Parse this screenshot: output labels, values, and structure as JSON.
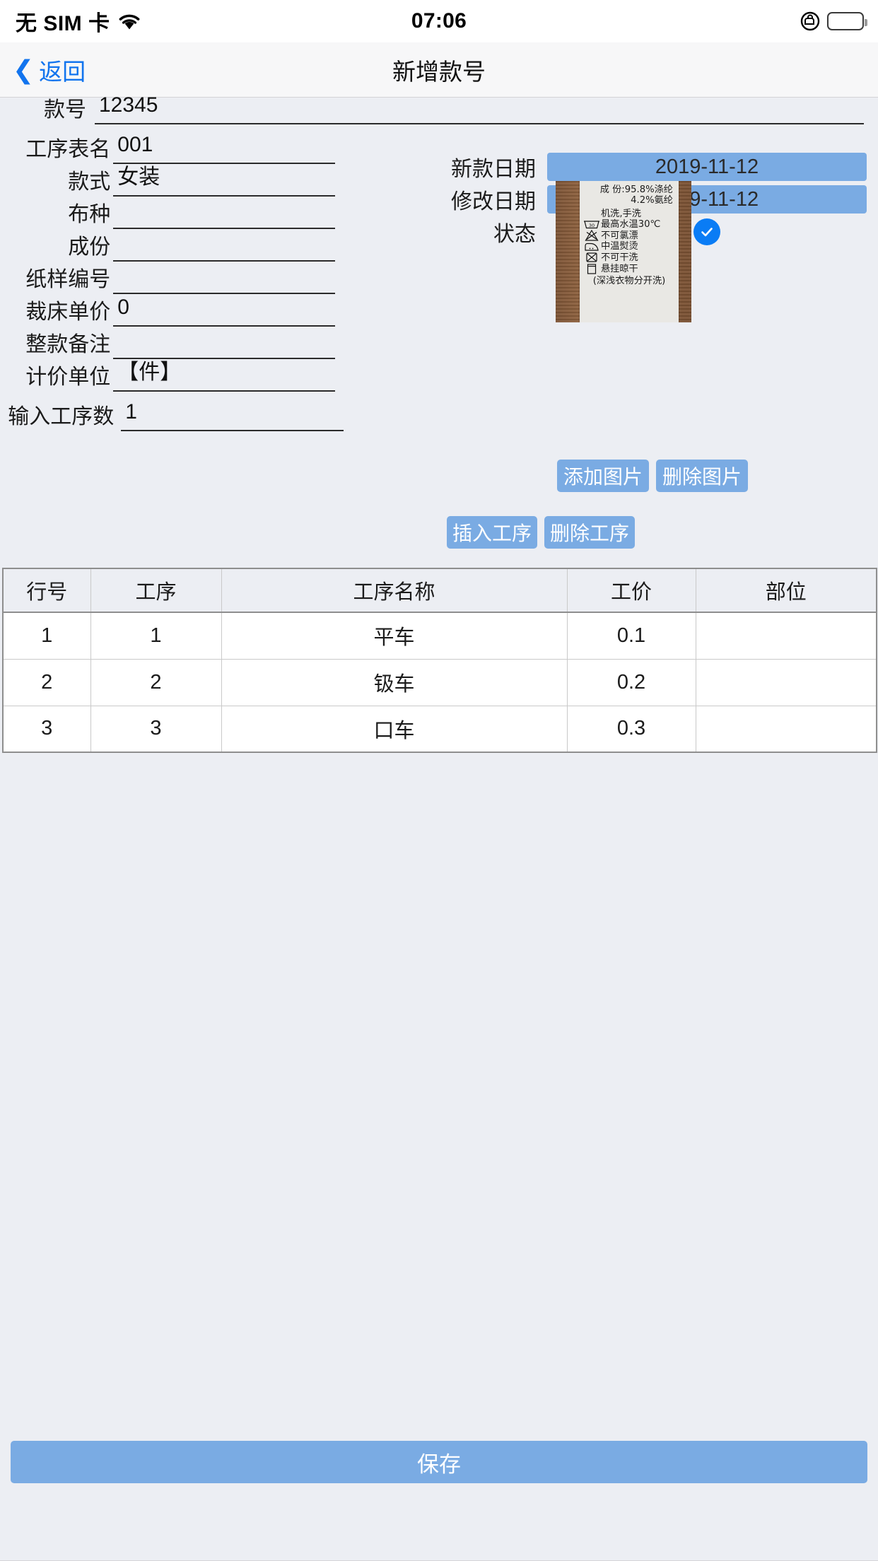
{
  "status_bar": {
    "carrier": "无 SIM 卡",
    "wifi_icon": "wifi-icon",
    "time": "07:06",
    "orientation_lock_icon": "rotation-lock-icon",
    "battery_icon": "battery-full-icon"
  },
  "nav_bar": {
    "back_icon": "chevron-left-icon",
    "back_label": "返回",
    "title": "新增款号"
  },
  "form_left": [
    {
      "label": "款号",
      "value": "12345"
    },
    {
      "label": "工序表名",
      "value": "001"
    },
    {
      "label": "款式",
      "value": "女装"
    },
    {
      "label": "布种",
      "value": ""
    },
    {
      "label": "成份",
      "value": ""
    },
    {
      "label": "纸样编号",
      "value": ""
    },
    {
      "label": "裁床单价",
      "value": "0"
    },
    {
      "label": "整款备注",
      "value": ""
    },
    {
      "label": "计价单位",
      "value": "【件】"
    },
    {
      "label": "输入工序数",
      "value": "1"
    }
  ],
  "form_right": {
    "new_date_label": "新款日期",
    "new_date_value": "2019-11-12",
    "modify_date_label": "修改日期",
    "modify_date_value": "2019-11-12",
    "status_label": "状态",
    "status_checked_icon": "check-circle-icon"
  },
  "photo": {
    "alt": "care-label-photo",
    "lines": [
      "成 份:95.8%涤纶",
      "4.2%氨纶",
      "机洗,手洗",
      "最高水温30℃",
      "不可氯漂",
      "中温熨烫",
      "不可干洗",
      "悬挂晾干",
      "(深浅衣物分开洗)"
    ],
    "wash_temp": "30"
  },
  "photo_buttons": {
    "add": "添加图片",
    "remove": "删除图片"
  },
  "process_buttons": {
    "insert": "插入工序",
    "remove": "删除工序"
  },
  "table": {
    "headers": [
      "行号",
      "工序",
      "工序名称",
      "工价",
      "部位"
    ],
    "rows": [
      [
        "1",
        "1",
        "平车",
        "0.1",
        ""
      ],
      [
        "2",
        "2",
        "钑车",
        "0.2",
        ""
      ],
      [
        "3",
        "3",
        "口车",
        "0.3",
        ""
      ]
    ]
  },
  "footer": {
    "save_label": "保存"
  },
  "colors": {
    "page_bg": "#eceef3",
    "accent_blue": "#7aabe3",
    "link_blue": "#1274ee",
    "check_blue": "#0a7cf5"
  }
}
